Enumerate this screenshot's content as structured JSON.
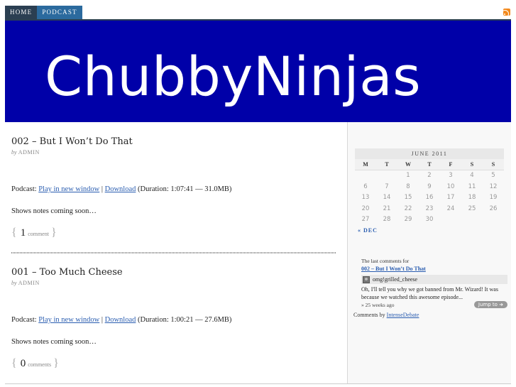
{
  "nav": {
    "items": [
      {
        "label": "HOME"
      },
      {
        "label": "PODCAST"
      }
    ],
    "rss_icon": "rss-feed-icon"
  },
  "banner": {
    "title": "ChubbyNinjas",
    "bg_color": "#0000a8"
  },
  "posts": [
    {
      "title": "002 – But I Won’t Do That",
      "by_prefix": "by",
      "author": "ADMIN",
      "podcast_prefix": "Podcast:",
      "play_link": "Play in new window",
      "separator": "|",
      "download_link": "Download",
      "duration": "(Duration: 1:07:41 — 31.0MB)",
      "notes": "Shows notes coming soon…",
      "comment_count": "1",
      "comment_word": "comment"
    },
    {
      "title": "001 – Too Much Cheese",
      "by_prefix": "by",
      "author": "ADMIN",
      "podcast_prefix": "Podcast:",
      "play_link": "Play in new window",
      "separator": "|",
      "download_link": "Download",
      "duration": "(Duration: 1:00:21 — 27.6MB)",
      "notes": "Shows notes coming soon…",
      "comment_count": "0",
      "comment_word": "comments"
    }
  ],
  "calendar": {
    "caption": "JUNE 2011",
    "weekdays": [
      "M",
      "T",
      "W",
      "T",
      "F",
      "S",
      "S"
    ],
    "weeks": [
      [
        "",
        "",
        "1",
        "2",
        "3",
        "4",
        "5"
      ],
      [
        "6",
        "7",
        "8",
        "9",
        "10",
        "11",
        "12"
      ],
      [
        "13",
        "14",
        "15",
        "16",
        "17",
        "18",
        "19"
      ],
      [
        "20",
        "21",
        "22",
        "23",
        "24",
        "25",
        "26"
      ],
      [
        "27",
        "28",
        "29",
        "30",
        "",
        "",
        ""
      ]
    ],
    "prev_link": "« DEC"
  },
  "comments_widget": {
    "heading": "The last comments for",
    "post_link": "002 – But I Won’t Do That",
    "user": "omg!grilled_cheese",
    "text": "Oh, I'll tell you why we got banned from Mr. Wizard! It was because we watched this awesome episode...",
    "time": "» 25 weeks ago",
    "jump_label": "Jump to ➜",
    "credit_prefix": "Comments by",
    "credit_link": "IntenseDebate"
  },
  "colors": {
    "link": "#2a5db0",
    "nav_home": "#2b3f52",
    "nav_podcast": "#2b6a9e"
  }
}
